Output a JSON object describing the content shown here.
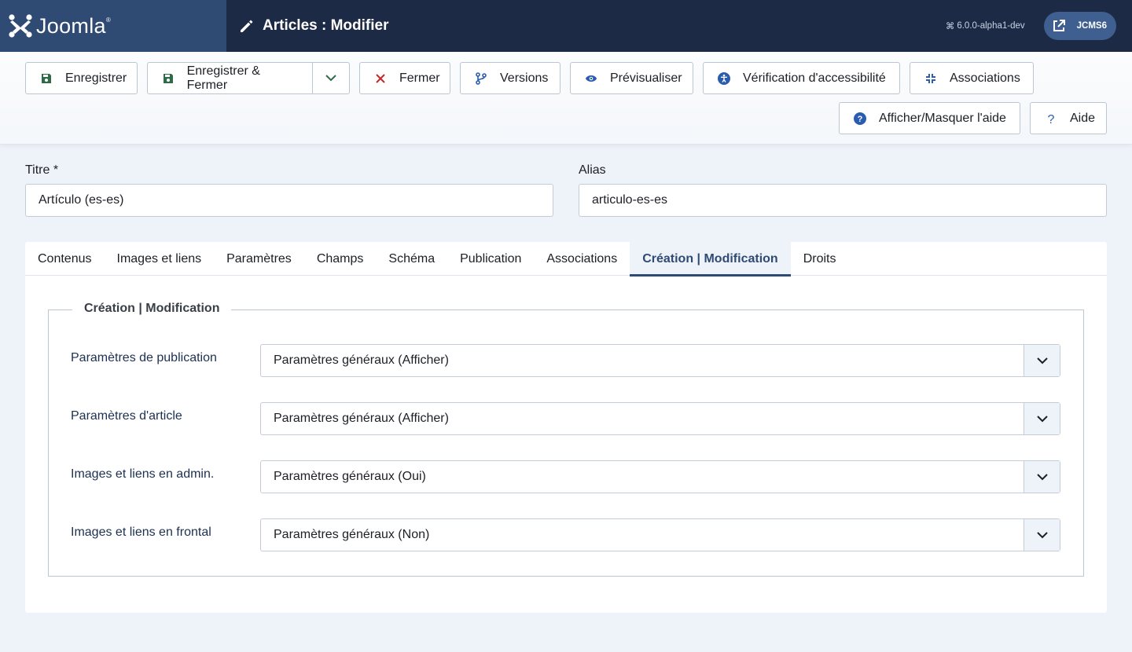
{
  "header": {
    "brand": "Joomla!",
    "page_title": "Articles : Modifier",
    "version": "6.0.0-alpha1-dev",
    "site_name": "JCMS6"
  },
  "toolbar": {
    "save": "Enregistrer",
    "save_close": "Enregistrer & Fermer",
    "close": "Fermer",
    "versions": "Versions",
    "preview": "Prévisualiser",
    "accessibility": "Vérification d'accessibilité",
    "associations": "Associations",
    "toggle_help": "Afficher/Masquer l'aide",
    "help": "Aide"
  },
  "form": {
    "title_label": "Titre *",
    "title_value": "Artículo (es-es)",
    "alias_label": "Alias",
    "alias_value": "articulo-es-es"
  },
  "tabs": [
    {
      "label": "Contenus"
    },
    {
      "label": "Images et liens"
    },
    {
      "label": "Paramètres"
    },
    {
      "label": "Champs"
    },
    {
      "label": "Schéma"
    },
    {
      "label": "Publication"
    },
    {
      "label": "Associations"
    },
    {
      "label": "Création | Modification",
      "active": true
    },
    {
      "label": "Droits"
    }
  ],
  "panel": {
    "legend": "Création | Modification",
    "rows": [
      {
        "label": "Paramètres de publication",
        "value": "Paramètres généraux (Afficher)"
      },
      {
        "label": "Paramètres d'article",
        "value": "Paramètres généraux (Afficher)"
      },
      {
        "label": "Images et liens en admin.",
        "value": "Paramètres généraux (Oui)"
      },
      {
        "label": "Images et liens en frontal",
        "value": "Paramètres généraux (Non)"
      }
    ]
  },
  "colors": {
    "header_bg": "#1c2a45",
    "brand_bg": "#2f4a73",
    "accent": "#2f4a73",
    "save_green": "#2f6b48",
    "close_red": "#c52827",
    "icon_blue": "#2a5db0"
  }
}
